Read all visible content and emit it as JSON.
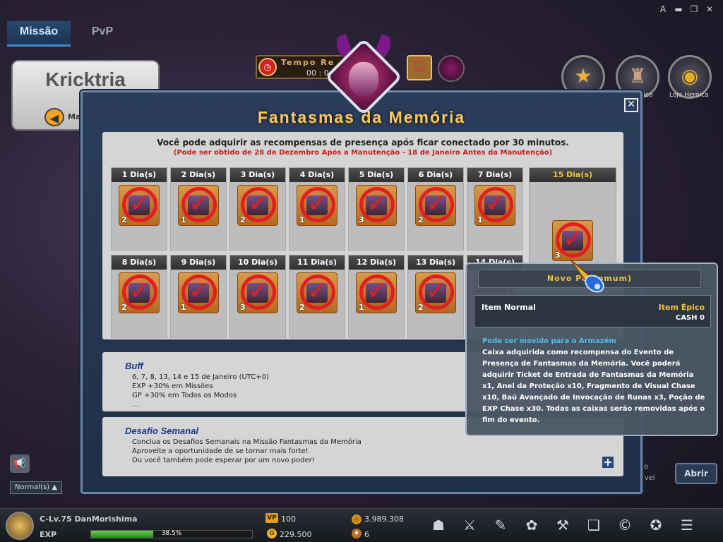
{
  "window": {
    "font_btn": "A",
    "min_btn": "▬",
    "max_btn": "❐",
    "close_btn": "✕"
  },
  "tabs": [
    {
      "label": "Missão",
      "active": true
    },
    {
      "label": "PvP",
      "active": false
    }
  ],
  "room": {
    "name": "Kricktria",
    "back_label": "Ma"
  },
  "timer": {
    "label": "Tempo Re",
    "value": "00 : 0"
  },
  "right_buttons": {
    "epic_label": "Épico",
    "shop_label": "Loja Heróica"
  },
  "modal": {
    "title": "Fantasmas da Memória",
    "close": "✕",
    "info": "Você pode adquirir as recompensas de presença após ficar conectado por 30 minutos.",
    "period": "(Pode ser obtido de 28 de Dezembro Após a Manutenção - 18 de Janeiro Antes da Manutenção)",
    "days": [
      {
        "label": "1 Dia(s)",
        "qty": "2"
      },
      {
        "label": "2 Dia(s)",
        "qty": "1"
      },
      {
        "label": "3 Dia(s)",
        "qty": "2"
      },
      {
        "label": "4 Dia(s)",
        "qty": "1"
      },
      {
        "label": "5 Dia(s)",
        "qty": "3"
      },
      {
        "label": "6 Dia(s)",
        "qty": "2"
      },
      {
        "label": "7 Dia(s)",
        "qty": "1"
      },
      {
        "label": "8 Dia(s)",
        "qty": "2"
      },
      {
        "label": "9 Dia(s)",
        "qty": "1"
      },
      {
        "label": "10 Dia(s)",
        "qty": "3"
      },
      {
        "label": "11 Dia(s)",
        "qty": "2"
      },
      {
        "label": "12 Dia(s)",
        "qty": "1"
      },
      {
        "label": "13 Dia(s)",
        "qty": "2"
      },
      {
        "label": "14 Dia(s)",
        "qty": ""
      }
    ],
    "day15": {
      "label": "15 Dia(s)",
      "qty": "3"
    },
    "buff": {
      "title": "Buff",
      "lines": [
        "6, 7, 8, 13, 14 e 15 de Janeiro (UTC+0)",
        "EXP +30% em Missões",
        "GP +30% em Todos os Modos",
        "..."
      ]
    },
    "weekly": {
      "title": "Desafio Semanal",
      "lines": [
        "Conclua os Desafios Semanais na Missão Fantasmas da Memória",
        "Aproveite a oportunidade de se tornar mais forte!",
        "Ou você também pode esperar por um novo poder!"
      ],
      "plus": "+"
    }
  },
  "tooltip": {
    "title": "Novo Po         Comum)",
    "item_normal": "Item Normal",
    "item_epic": "Item Épico",
    "cash": "CASH 0",
    "storage": "Pode ser movido para o Armazém",
    "description": "Caixa adquirida como recompensa do Evento de Presença de Fantasmas da Memória. Você poderá adquirir Ticket de Entrada de Fantasmas da Memória x1, Anel da Proteção x10, Fragmento de Visual Chase x10, Baú Avançado de Invocação de Runas x3, Poção de EXP Chase x30. Todas as caixas serão removidas após o fim do evento."
  },
  "behind": {
    "label1": "ão",
    "label2": "tivel",
    "open_button": "Abrir"
  },
  "chat": {
    "mode": "Normal(s)  ▲"
  },
  "player": {
    "level_name": "C-Lv.75 DanMorishima",
    "exp_label": "EXP",
    "exp_percent": 38.5,
    "exp_text": "38.5%",
    "vp_label": "VP",
    "vp": "100",
    "gp": "229.500",
    "gc": "3.989.308",
    "gem": "6"
  },
  "bar_icons": [
    "character-icon",
    "weapon-icon",
    "skill-icon",
    "gift-icon",
    "auction-icon",
    "book-icon",
    "coin-icon",
    "badge-icon",
    "menu-icon"
  ]
}
